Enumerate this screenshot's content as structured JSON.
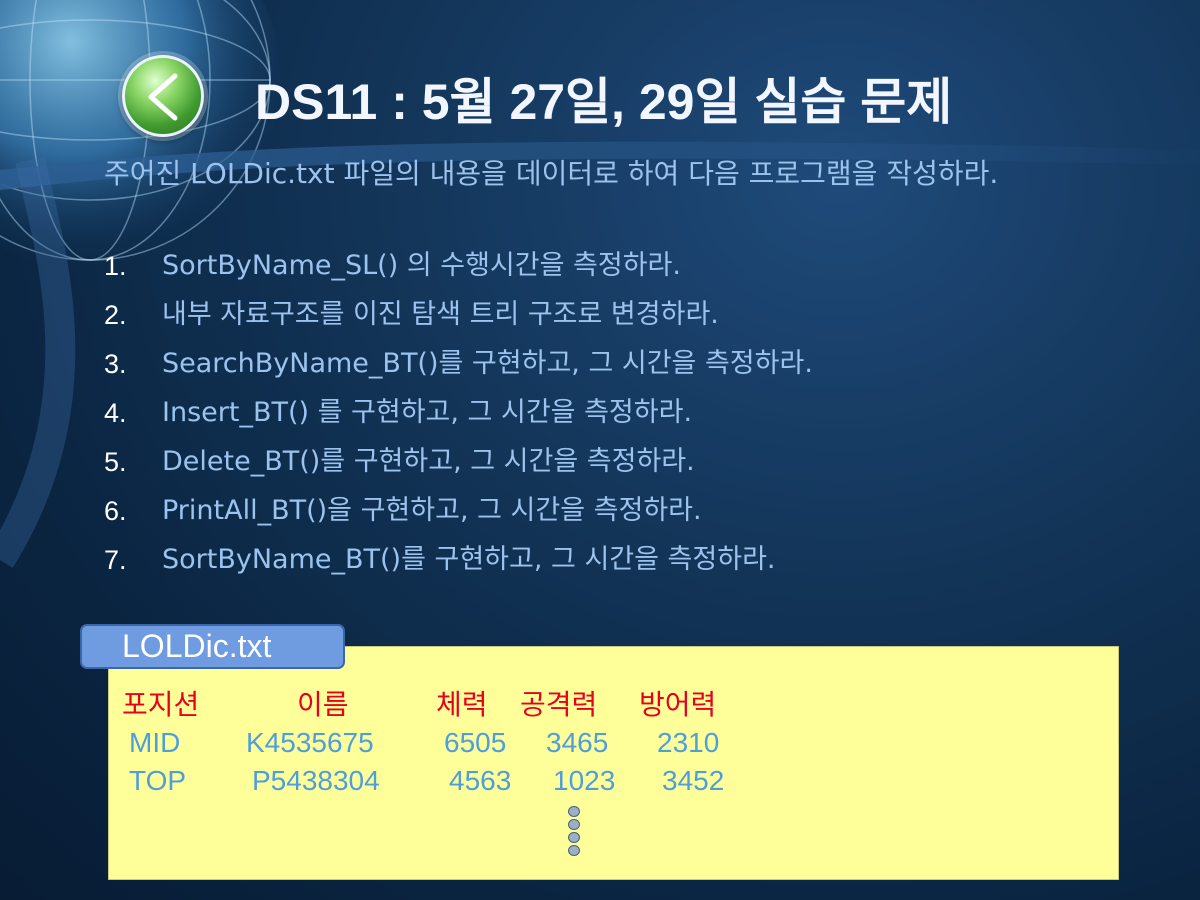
{
  "slide": {
    "title": "DS11 : 5월 27일, 29일 실습 문제",
    "intro": "주어진 LOLDic.txt 파일의 내용을 데이터로 하여 다음 프로그램을 작성하라.",
    "tasks": [
      {
        "num": "1.",
        "text": "SortByName_SL() 의 수행시간을 측정하라."
      },
      {
        "num": "2.",
        "text": "내부 자료구조를 이진 탐색 트리 구조로 변경하라."
      },
      {
        "num": "3.",
        "text": "SearchByName_BT()를 구현하고, 그 시간을 측정하라."
      },
      {
        "num": "4.",
        "text": "Insert_BT() 를 구현하고, 그 시간을 측정하라."
      },
      {
        "num": "5.",
        "text": "Delete_BT()를 구현하고, 그 시간을 측정하라."
      },
      {
        "num": "6.",
        "text": "PrintAll_BT()을 구현하고, 그 시간을 측정하라."
      },
      {
        "num": "7.",
        "text": "SortByName_BT()를 구현하고, 그 시간을 측정하라."
      }
    ]
  },
  "file": {
    "tab_label": "LOLDic.txt",
    "headers": [
      "포지션",
      "이름",
      "체력",
      "공격력",
      "방어력"
    ],
    "rows": [
      [
        "MID",
        "K4535675",
        "6505",
        "3465",
        "2310"
      ],
      [
        "TOP",
        "P5438304",
        "4563",
        "1023",
        "3452"
      ]
    ],
    "continuation_icon": "vertical-ellipsis-icon"
  },
  "icons": {
    "back": "chevron-left-icon",
    "background": "globe-grid-icon"
  },
  "colors": {
    "background": "#0a2440",
    "title": "#f2f6ff",
    "body_text": "#9cc3ee",
    "header_text": "#e8001f",
    "data_text": "#4f9edc",
    "file_box": "#ffff99",
    "file_tab": "#6f9be0",
    "back_button": "#5bb43c"
  }
}
